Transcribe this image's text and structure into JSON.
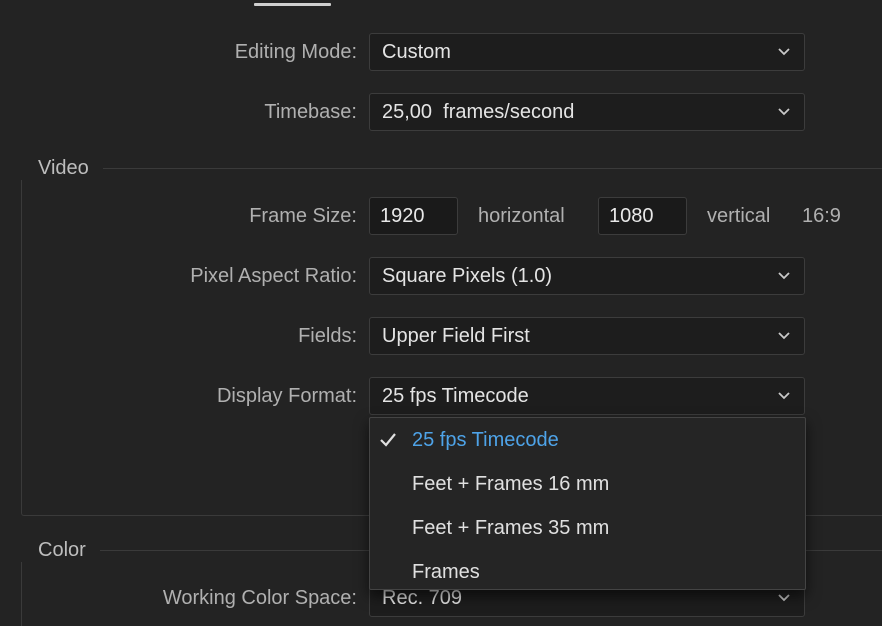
{
  "editing_mode": {
    "label": "Editing Mode:",
    "value": "Custom"
  },
  "timebase": {
    "label": "Timebase:",
    "value": "25,00  frames/second"
  },
  "video": {
    "title": "Video",
    "frame_size": {
      "label": "Frame Size:",
      "width": "1920",
      "horizontal_label": "horizontal",
      "height": "1080",
      "vertical_label": "vertical",
      "aspect": "16:9"
    },
    "pixel_aspect_ratio": {
      "label": "Pixel Aspect Ratio:",
      "value": "Square Pixels (1.0)"
    },
    "fields": {
      "label": "Fields:",
      "value": "Upper Field First"
    },
    "display_format": {
      "label": "Display Format:",
      "value": "25 fps Timecode",
      "options": [
        {
          "label": "25 fps Timecode",
          "selected": true
        },
        {
          "label": "Feet + Frames 16 mm",
          "selected": false
        },
        {
          "label": "Feet + Frames 35 mm",
          "selected": false
        },
        {
          "label": "Frames",
          "selected": false
        }
      ]
    }
  },
  "color": {
    "title": "Color",
    "working_color_space": {
      "label": "Working Color Space:",
      "value": "Rec. 709"
    }
  },
  "colors": {
    "background": "#232323",
    "selected_option": "#4ea3e8"
  }
}
